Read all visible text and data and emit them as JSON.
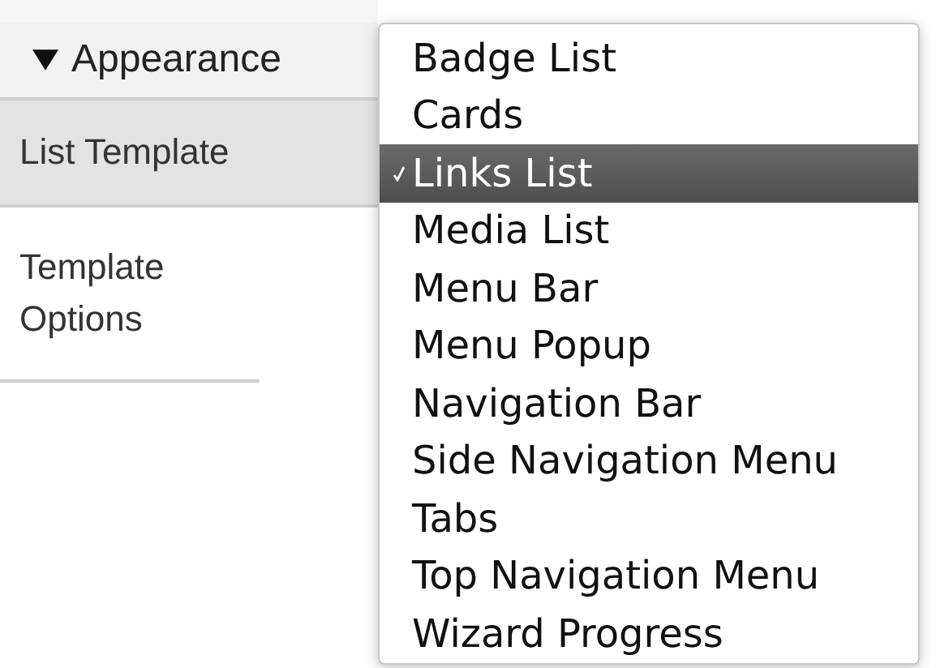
{
  "section": {
    "title": "Appearance",
    "expanded": true
  },
  "rows": [
    {
      "label": "List Template",
      "highlighted": true
    },
    {
      "label": "Template Options",
      "highlighted": false
    }
  ],
  "menu": {
    "items": [
      {
        "label": "Badge List",
        "selected": false
      },
      {
        "label": "Cards",
        "selected": false
      },
      {
        "label": "Links List",
        "selected": true
      },
      {
        "label": "Media List",
        "selected": false
      },
      {
        "label": "Menu Bar",
        "selected": false
      },
      {
        "label": "Menu Popup",
        "selected": false
      },
      {
        "label": "Navigation Bar",
        "selected": false
      },
      {
        "label": "Side Navigation Menu",
        "selected": false
      },
      {
        "label": "Tabs",
        "selected": false
      },
      {
        "label": "Top Navigation Menu",
        "selected": false
      },
      {
        "label": "Wizard Progress",
        "selected": false
      }
    ]
  }
}
